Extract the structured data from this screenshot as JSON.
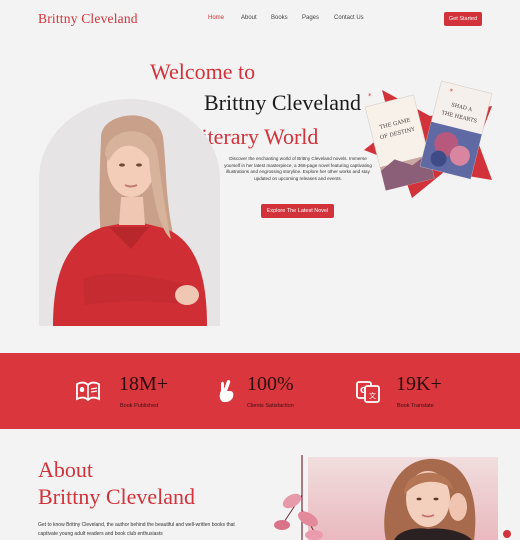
{
  "nav": {
    "brand": "Brittny Cleveland",
    "items": [
      {
        "label": "Home",
        "active": true
      },
      {
        "label": "About",
        "active": false
      },
      {
        "label": "Books",
        "active": false
      },
      {
        "label": "Pages",
        "active": false
      },
      {
        "label": "Contact Us",
        "active": false
      }
    ],
    "cta_label": "Get Started"
  },
  "hero": {
    "line1": "Welcome to",
    "line2": "Brittny Cleveland",
    "line3": "Literary World",
    "description": "Discover the enchanting world of Brittny Cleveland novels. Immerse yourself in her latest masterpiece, a 368-page novel featuring captivating illustrations and engrossing storyline. Explore her other works and stay updated on upcoming releases and events.",
    "button_label": "Explore The Latest Novel",
    "book1_title": "THE GAME OF DESTINY",
    "book2_title": "SHAD A THE HEARTS",
    "book_mark": "*"
  },
  "stats": [
    {
      "icon": "open-book-icon",
      "value": "18M+",
      "label": "Book Published"
    },
    {
      "icon": "crossed-fingers-icon",
      "value": "100%",
      "label": "Clients Satisfaction"
    },
    {
      "icon": "translate-icon",
      "value": "19K+",
      "label": "Book Translate"
    }
  ],
  "about": {
    "title_line1": "About",
    "title_line2": "Brittny Cleveland",
    "description": "Get to know Brittny Cleveland, the author behind the beautiful and well-written books that captivate young adult readers and book club enthusiasts"
  },
  "colors": {
    "accent": "#d2323a",
    "stats_bg": "#d9363e",
    "page_bg": "#f4f3f3"
  }
}
